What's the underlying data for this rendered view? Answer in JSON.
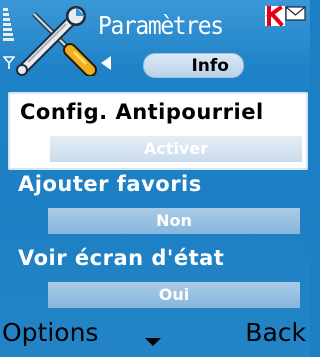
{
  "header": {
    "title": "Paramètres",
    "active_tab": "Info",
    "icons": {
      "signal": "signal-strength-icon",
      "app": "tools-icon",
      "kaspersky": "kaspersky-k-icon",
      "message": "envelope-icon",
      "tab_back": "tab-left-arrow-icon"
    }
  },
  "settings": [
    {
      "label": "Config. Antipourriel",
      "value": "Activer",
      "selected": true
    },
    {
      "label": "Ajouter favoris",
      "value": "Non",
      "selected": false
    },
    {
      "label": "Voir écran d'état",
      "value": "Oui",
      "selected": false
    }
  ],
  "softkeys": {
    "left": "Options",
    "middle_icon": "menu-down-arrow-icon",
    "right": "Back"
  },
  "colors": {
    "background": "#1d7fc3",
    "highlight": "#ffffff",
    "value_bar": "#a9cbe6",
    "kaspersky_red": "#e2001a"
  }
}
